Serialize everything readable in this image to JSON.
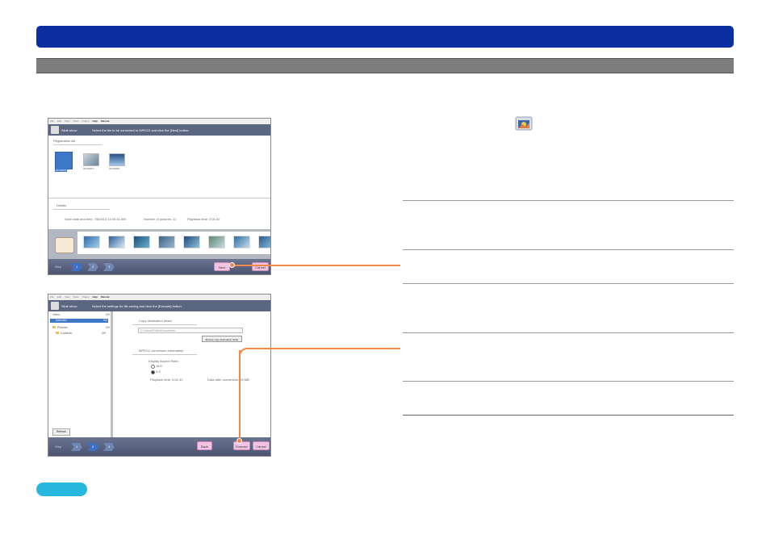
{
  "win1": {
    "menu": [
      "File",
      "Edit",
      "View",
      "Tools",
      "Output",
      "Help",
      "Manual"
    ],
    "header_label": "Slide show",
    "instruction": "Select the file to be converted to MPEG2 and click the [Next] button.",
    "registration_title": "Registration list",
    "thumb_labels": [
      "20130801",
      "20130813",
      "20130820"
    ],
    "details_title": "Details",
    "save_date": "Save date and time: 7/8/2013 11:00:31 AM",
    "num_pictures": "Number of pictures: 11",
    "playback_time": "Playback time: 0:01:32",
    "step_label": "Step",
    "steps": [
      "1",
      "2",
      "3"
    ],
    "next_label": "Next",
    "cancel_label": "Cancel"
  },
  "win2": {
    "menu": [
      "File",
      "Edit",
      "View",
      "Tools",
      "Output",
      "Help",
      "Manual"
    ],
    "header_label": "Slide show",
    "instruction": "Select the settings for file saving and click the [Execute] button.",
    "tree": [
      {
        "label": "Video",
        "count": "0/0"
      },
      {
        "label": "Selected",
        "count": "0/0"
      },
      {
        "label": "Pictures",
        "count": "0/0"
      },
      {
        "label": "Contents",
        "count": "0/0"
      }
    ],
    "refresh_label": "Refresh",
    "copy_dest_title": "Copy destination folder",
    "copy_dest_path": "C:\\Users\\Public\\Documents",
    "browse_label": "Browse copy destination folder",
    "mpeg2_title": "MPEG2 conversion information",
    "aspect_label": "Display Aspect Ratio",
    "radio_options": [
      "16:9",
      "4:3"
    ],
    "playback_time": "Playback time: 0:01:32",
    "data_size": "Data after conversion:   33 MB",
    "step_label": "Step",
    "steps": [
      "1",
      "2",
      "3"
    ],
    "back_label": "Back",
    "execute_label": "Execute",
    "cancel_label": "Cancel"
  },
  "colors": {
    "title_bar": "#0b2fa0",
    "section_bar": "#7d7d7d",
    "connector": "#f0884a",
    "note_pill": "#27b8dd",
    "step_bar": "#4b5470",
    "pink_button": "#f2c3e3"
  },
  "icons": {
    "slideshow": "slideshow-icon",
    "folder": "folder-icon"
  }
}
